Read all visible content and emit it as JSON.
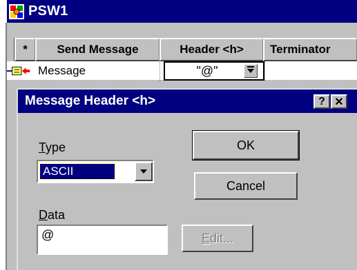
{
  "window": {
    "title": "PSW1",
    "icon": "app-icon"
  },
  "grid": {
    "columns": [
      "*",
      "Send Message",
      "Header <h>",
      "Terminator"
    ],
    "rows": [
      {
        "marker_icon": "message-pointer-icon",
        "send_message": "Message",
        "header": "\"@\""
      }
    ]
  },
  "dialog": {
    "title": "Message Header <h>",
    "help_label": "?",
    "close_label": "✕",
    "type_label_ul": "T",
    "type_label_rest": "ype",
    "type_value": "ASCII",
    "data_label_ul": "D",
    "data_label_rest": "ata",
    "data_value": "@",
    "ok_label": "OK",
    "cancel_label": "Cancel",
    "edit_label_ul": "E",
    "edit_label_rest": "dit..."
  },
  "colors": {
    "titlebar": "#000080",
    "face": "#c0c0c0"
  }
}
